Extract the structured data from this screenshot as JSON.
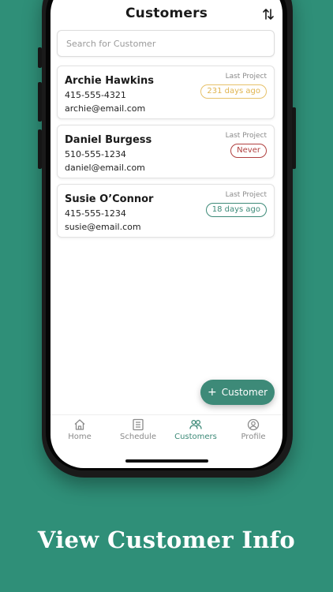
{
  "header": {
    "title": "Customers",
    "sort_icon": "sort-arrows-icon"
  },
  "search": {
    "placeholder": "Search for Customer",
    "value": ""
  },
  "customers": [
    {
      "name": "Archie Hawkins",
      "phone": "415-555-4321",
      "email": "archie@email.com",
      "last_project_label": "Last Project",
      "last_project_value": "231 days ago",
      "badge_color": "#e7c16a"
    },
    {
      "name": "Daniel Burgess",
      "phone": "510-555-1234",
      "email": "daniel@email.com",
      "last_project_label": "Last Project",
      "last_project_value": "Never",
      "badge_color": "#b0403f"
    },
    {
      "name": "Susie O’Connor",
      "phone": "415-555-1234",
      "email": "susie@email.com",
      "last_project_label": "Last Project",
      "last_project_value": "18 days ago",
      "badge_color": "#3d8a78"
    }
  ],
  "fab": {
    "label": "Customer",
    "icon": "plus-icon"
  },
  "nav": {
    "items": [
      {
        "label": "Home",
        "icon": "home-icon",
        "active": false
      },
      {
        "label": "Schedule",
        "icon": "list-icon",
        "active": false
      },
      {
        "label": "Customers",
        "icon": "users-icon",
        "active": true
      },
      {
        "label": "Profile",
        "icon": "profile-icon",
        "active": false
      }
    ],
    "active_color": "#3d8a78",
    "inactive_color": "#8a8a8a"
  },
  "caption": "View Customer Info",
  "colors": {
    "background": "#2f8f78",
    "accent": "#3d8a78"
  }
}
